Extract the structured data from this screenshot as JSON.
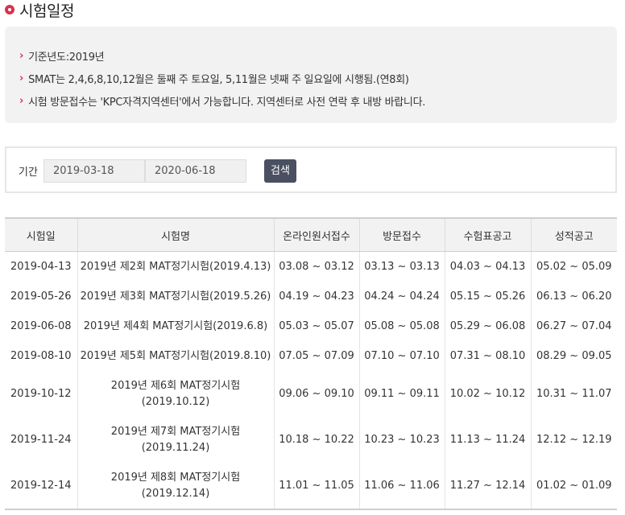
{
  "title": "시험일정",
  "notice": [
    "기준년도:2019년",
    "SMAT는 2,4,6,8,10,12월은 둘째 주 토요일, 5,11월은 넷째 주 일요일에 시행됨.(연8회)",
    "시험 방문접수는 'KPC자격지역센터'에서 가능합니다. 지역센터로 사전 연락 후 내방 바랍니다."
  ],
  "search": {
    "label": "기간",
    "start_date": "2019-03-18",
    "end_date": "2020-06-18",
    "button_label": "검색"
  },
  "table": {
    "headers": [
      "시험일",
      "시험명",
      "온라인원서접수",
      "방문접수",
      "수험표공고",
      "성적공고"
    ],
    "rows": [
      {
        "date": "2019-04-13",
        "name": "2019년 제2회 MAT정기시험(2019.4.13)",
        "online": "03.08 ~ 03.12",
        "visit": "03.13 ~ 03.13",
        "ticket": "04.03 ~ 04.13",
        "result": "05.02 ~ 05.09"
      },
      {
        "date": "2019-05-26",
        "name": "2019년 제3회 MAT정기시험(2019.5.26)",
        "online": "04.19 ~ 04.23",
        "visit": "04.24 ~ 04.24",
        "ticket": "05.15 ~ 05.26",
        "result": "06.13 ~ 06.20"
      },
      {
        "date": "2019-06-08",
        "name": "2019년 제4회 MAT정기시험(2019.6.8)",
        "online": "05.03 ~ 05.07",
        "visit": "05.08 ~ 05.08",
        "ticket": "05.29 ~ 06.08",
        "result": "06.27 ~ 07.04"
      },
      {
        "date": "2019-08-10",
        "name": "2019년 제5회 MAT정기시험(2019.8.10)",
        "online": "07.05 ~ 07.09",
        "visit": "07.10 ~ 07.10",
        "ticket": "07.31 ~ 08.10",
        "result": "08.29 ~ 09.05"
      },
      {
        "date": "2019-10-12",
        "name": "2019년 제6회 MAT정기시험\n(2019.10.12)",
        "online": "09.06 ~ 09.10",
        "visit": "09.11 ~ 09.11",
        "ticket": "10.02 ~ 10.12",
        "result": "10.31 ~ 11.07"
      },
      {
        "date": "2019-11-24",
        "name": "2019년 제7회 MAT정기시험\n(2019.11.24)",
        "online": "10.18 ~ 10.22",
        "visit": "10.23 ~ 10.23",
        "ticket": "11.13 ~ 11.24",
        "result": "12.12 ~ 12.19"
      },
      {
        "date": "2019-12-14",
        "name": "2019년 제8회 MAT정기시험\n(2019.12.14)",
        "online": "11.01 ~ 11.05",
        "visit": "11.06 ~ 11.06",
        "ticket": "11.27 ~ 12.14",
        "result": "01.02 ~ 01.09"
      }
    ]
  },
  "colors": {
    "accent": "#d6334d",
    "button_bg": "#4a5060",
    "panel_bg": "#f2f2f2"
  }
}
